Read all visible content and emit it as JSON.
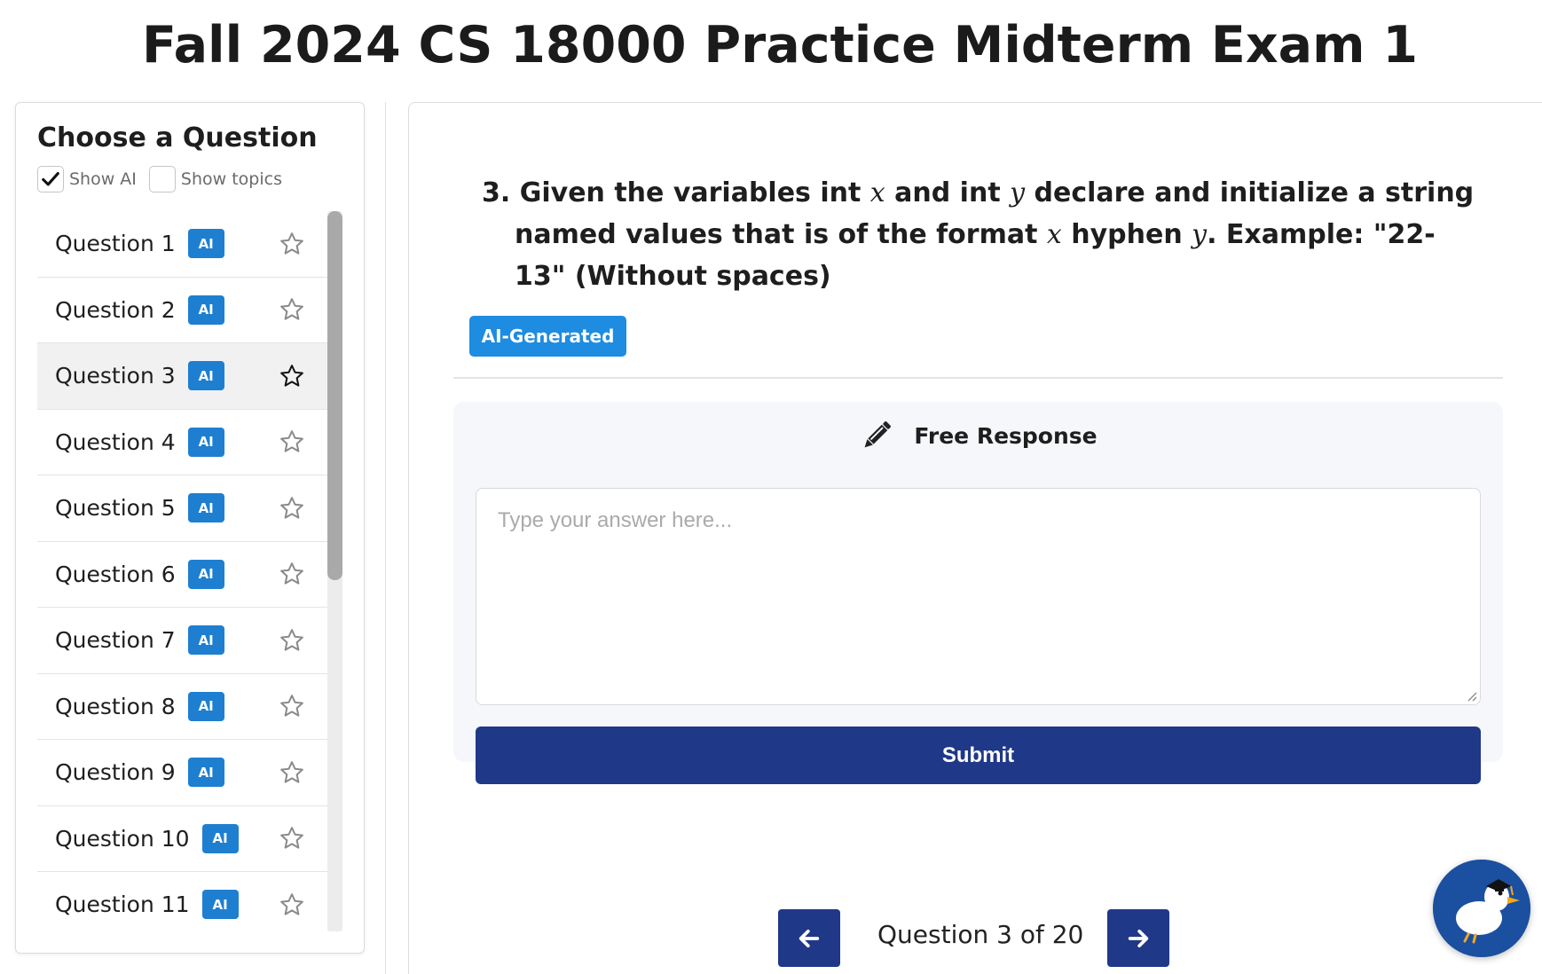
{
  "page": {
    "title": "Fall 2024 CS 18000 Practice Midterm Exam 1"
  },
  "sidebar": {
    "heading": "Choose a Question",
    "filters": [
      {
        "label": "Show AI",
        "checked": true
      },
      {
        "label": "Show topics",
        "checked": false
      }
    ],
    "badge_label": "AI",
    "active_index": 2,
    "items": [
      {
        "label": "Question 1"
      },
      {
        "label": "Question 2"
      },
      {
        "label": "Question 3"
      },
      {
        "label": "Question 4"
      },
      {
        "label": "Question 5"
      },
      {
        "label": "Question 6"
      },
      {
        "label": "Question 7"
      },
      {
        "label": "Question 8"
      },
      {
        "label": "Question 9"
      },
      {
        "label": "Question 10"
      },
      {
        "label": "Question 11"
      }
    ]
  },
  "question": {
    "number": "3.",
    "parts": {
      "p1": "Given the variables int ",
      "var_x": "x",
      "p2": " and int ",
      "var_y": "y",
      "p3": " declare and initialize a string named values that is of the format ",
      "var_x2": "x",
      "p4": " hyphen ",
      "var_y2": "y",
      "p5": ". Example: \"22-13\" (Without spaces)"
    },
    "tag": "AI-Generated"
  },
  "response": {
    "title": "Free Response",
    "placeholder": "Type your answer here...",
    "value": "",
    "submit_label": "Submit"
  },
  "navigation": {
    "counter": "Question 3 of 20"
  },
  "colors": {
    "primary": "#1f3888",
    "ai_badge": "#1e7fd1",
    "tag": "#1e8ce0",
    "active_row": "#f1f1f1"
  },
  "icons": {
    "checkbox": "check-icon",
    "favorite": "star-outline-icon",
    "response": "pencil-icon",
    "prev": "arrow-left-icon",
    "next": "arrow-right-icon",
    "assistant": "duck-mascot-icon"
  }
}
